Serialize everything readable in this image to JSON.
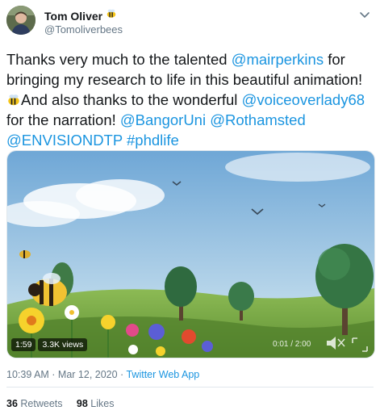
{
  "author": {
    "name": "Tom Oliver",
    "handle": "@Tomoliverbees",
    "badge_icon": "bee-emoji-icon"
  },
  "tweet": {
    "segments": [
      {
        "t": "Thanks very much to the talented ",
        "link": false
      },
      {
        "t": "@mairperkins",
        "link": true
      },
      {
        "t": " for bringing my research to life in this beautiful animation! ",
        "link": false
      },
      {
        "t": "bee-emoji",
        "emoji": true
      },
      {
        "t": "And also thanks to the wonderful ",
        "link": false
      },
      {
        "t": "@voiceoverlady68",
        "link": true
      },
      {
        "t": " for the narration! ",
        "link": false
      },
      {
        "t": "@BangorUni",
        "link": true
      },
      {
        "t": " ",
        "link": false
      },
      {
        "t": "@Rothamsted",
        "link": true
      },
      {
        "t": " ",
        "link": false
      },
      {
        "t": "@ENVISIONDTP",
        "link": true
      },
      {
        "t": " ",
        "link": false
      },
      {
        "t": "#phdlife",
        "link": true
      }
    ]
  },
  "video": {
    "duration": "1:59",
    "views": "3.3K views",
    "timer": "0:01 / 2:00"
  },
  "meta": {
    "time": "10:39 AM · Mar 12, 2020 · ",
    "app": "Twitter Web App"
  },
  "stats": {
    "retweets_count": "36",
    "retweets_label": "Retweets",
    "likes_count": "98",
    "likes_label": "Likes"
  },
  "colors": {
    "link": "#1b95e0",
    "text": "#14171a",
    "secondary": "#657786"
  }
}
